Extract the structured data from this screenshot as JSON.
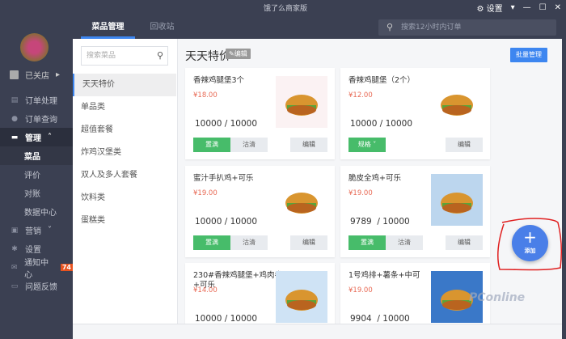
{
  "app": {
    "title": "饿了么商家版",
    "settings": "设置"
  },
  "tabs": [
    {
      "label": "菜品管理"
    },
    {
      "label": "回收站"
    }
  ],
  "order_search": {
    "placeholder": "搜索12小时内订单"
  },
  "sidebar": {
    "shop_status": "已关店",
    "items": [
      {
        "label": "订单处理",
        "icon": "list-icon"
      },
      {
        "label": "订单查询",
        "icon": "clock-icon"
      },
      {
        "label": "管理",
        "icon": "monitor-icon"
      },
      {
        "label": "菜品"
      },
      {
        "label": "评价"
      },
      {
        "label": "对账"
      },
      {
        "label": "数据中心"
      },
      {
        "label": "营销",
        "icon": "camera-icon"
      },
      {
        "label": "设置",
        "icon": "gear-icon"
      },
      {
        "label": "通知中心",
        "icon": "mail-icon",
        "badge": "74"
      },
      {
        "label": "问题反馈",
        "icon": "chat-icon"
      }
    ]
  },
  "categories": {
    "search_placeholder": "搜索菜品",
    "items": [
      "天天特价",
      "单品类",
      "超值套餐",
      "炸鸡汉堡类",
      "双人及多人套餐",
      "饮料类",
      "蛋糕类"
    ]
  },
  "section": {
    "title": "天天特价",
    "edit": "编辑",
    "batch": "批量管理"
  },
  "buttons": {
    "fill": "置满",
    "clear": "沽清",
    "edit": "编辑",
    "spec": "规格"
  },
  "dishes": [
    {
      "name": "香辣鸡腿堡3个",
      "price": "¥18.00",
      "stock": "10000 / 10000"
    },
    {
      "name": "香辣鸡腿堡（2个）",
      "price": "¥12.00",
      "stock": "10000 / 10000"
    },
    {
      "name": "蜜汁手扒鸡+可乐",
      "price": "¥19.00",
      "stock": "10000 / 10000"
    },
    {
      "name": "脆皮全鸡+可乐",
      "price": "¥19.00",
      "stock": "9789  / 10000"
    },
    {
      "name": "230#香辣鸡腿堡+鸡肉卷+可乐",
      "price": "¥14.00",
      "stock": "10000 / 10000"
    },
    {
      "name": "1号鸡排+薯条+中可",
      "price": "¥19.00",
      "stock": "9904  / 10000"
    }
  ],
  "fab": {
    "label": "添加"
  },
  "watermark": "PConline"
}
